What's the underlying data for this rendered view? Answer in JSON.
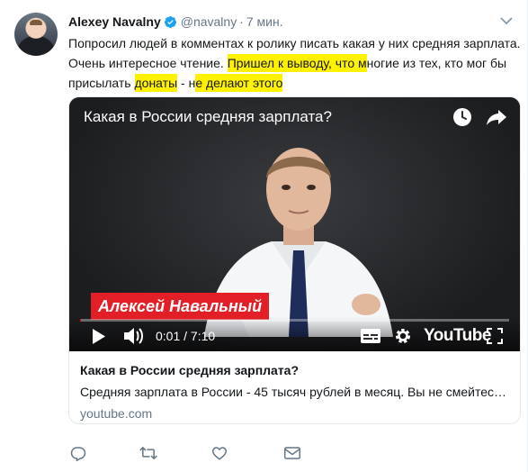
{
  "tweet": {
    "author_name": "Alexey Navalny",
    "handle": "@navalny",
    "separator": "·",
    "time": "7 мин.",
    "text_parts": [
      "Попросил людей в комментах к ролику писать какая у них средняя зарплата. Очень интересное чтение. ",
      "Пришел к выводу, что м",
      "ногие из тех, кто мог бы присылать ",
      "донаты",
      " - н",
      "е делают этого"
    ],
    "highlight_color": "#fff200"
  },
  "video": {
    "title": "Какая в России средняя зарплата?",
    "name_caption": "Алексей Навальный",
    "time_display": "0:01 / 7:10",
    "brand": "YouTube",
    "progress": 0.0023
  },
  "card": {
    "title": "Какая в России средняя зарплата?",
    "description": "Средняя зарплата в России - 45 тысяч рублей в месяц. Вы не смейтес…",
    "domain": "youtube.com"
  },
  "icons": {
    "verified": "verified-badge-icon",
    "caret": "chevron-down-icon",
    "reply": "reply-icon",
    "retweet": "retweet-icon",
    "like": "heart-icon",
    "dm": "envelope-icon"
  },
  "colors": {
    "accent": "#1da1f2",
    "secondary_text": "#657786",
    "action_icon": "#657786",
    "name_bar": "#e21f26"
  }
}
